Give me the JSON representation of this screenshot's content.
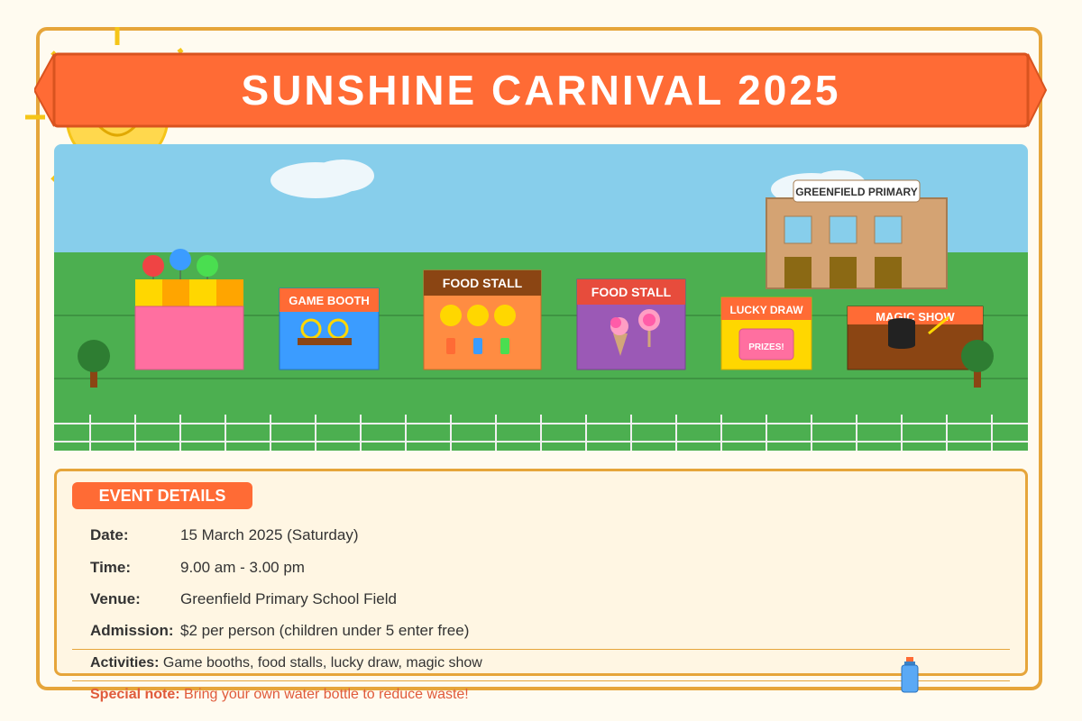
{
  "title": "SUNSHINE CARNIVAL 2025",
  "scene": {
    "school_sign": "GREENFIELD PRIMARY",
    "booths": [
      {
        "label": "GAME BOOTH"
      },
      {
        "label": "FOOD STALL"
      },
      {
        "label": "FOOD STALL"
      },
      {
        "label": "LUCKY DRAW"
      },
      {
        "label": "MAGIC SHOW"
      }
    ],
    "prize_label": "PRIZES!"
  },
  "details": {
    "header": "EVENT DETAILS",
    "rows": [
      {
        "label": "Date:",
        "value": "15 March 2025 (Saturday)"
      },
      {
        "label": "Time:",
        "value": "9.00 am - 3.00 pm"
      },
      {
        "label": "Venue:",
        "value": "Greenfield Primary School Field"
      },
      {
        "label": "Admission:",
        "value": "$2 per person (children under 5 enter free)"
      }
    ],
    "activities": {
      "label": "Activities:",
      "value": "Game booths, food stalls, lucky draw, magic show"
    },
    "special_note": {
      "label": "Special note:",
      "value": "Bring your own water bottle to reduce waste!"
    }
  },
  "colors": {
    "accent": "#ff6b35",
    "border": "#e6a53a",
    "sky": "#87ceeb",
    "grass": "#4caf50",
    "note": "#e05a3a"
  }
}
